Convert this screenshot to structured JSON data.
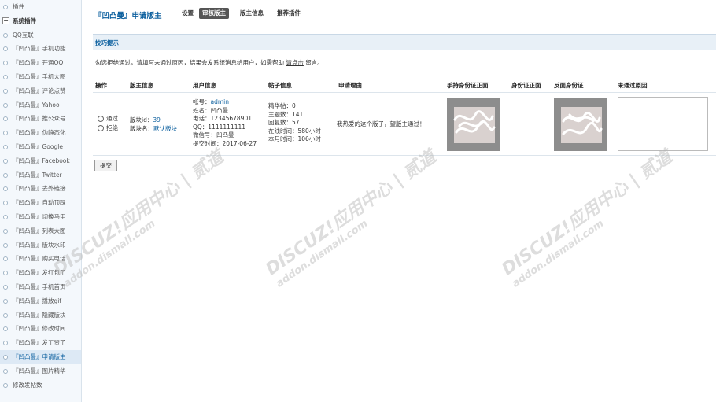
{
  "sidebar": {
    "items": [
      {
        "label": "插件",
        "type": "item"
      },
      {
        "label": "系统插件",
        "type": "group",
        "expander": "−"
      },
      {
        "label": "QQ互联",
        "type": "item"
      },
      {
        "label": "『凹凸曼』手机功能",
        "type": "item"
      },
      {
        "label": "『凹凸曼』开通QQ",
        "type": "item"
      },
      {
        "label": "『凹凸曼』手机大图",
        "type": "item"
      },
      {
        "label": "『凹凸曼』评论点赞",
        "type": "item"
      },
      {
        "label": "『凹凸曼』Yahoo",
        "type": "item"
      },
      {
        "label": "『凹凸曼』推公众号",
        "type": "item"
      },
      {
        "label": "『凹凸曼』伪静态化",
        "type": "item"
      },
      {
        "label": "『凹凸曼』Google",
        "type": "item"
      },
      {
        "label": "『凹凸曼』Facebook",
        "type": "item"
      },
      {
        "label": "『凹凸曼』Twitter",
        "type": "item"
      },
      {
        "label": "『凹凸曼』去外链接",
        "type": "item"
      },
      {
        "label": "『凹凸曼』自动顶踩",
        "type": "item"
      },
      {
        "label": "『凹凸曼』切换马甲",
        "type": "item"
      },
      {
        "label": "『凹凸曼』列表大图",
        "type": "item"
      },
      {
        "label": "『凹凸曼』版块水印",
        "type": "item"
      },
      {
        "label": "『凹凸曼』购买电话",
        "type": "item"
      },
      {
        "label": "『凹凸曼』发红包了",
        "type": "item"
      },
      {
        "label": "『凹凸曼』手机首页",
        "type": "item"
      },
      {
        "label": "『凹凸曼』播放gif",
        "type": "item"
      },
      {
        "label": "『凹凸曼』隐藏版块",
        "type": "item"
      },
      {
        "label": "『凹凸曼』修改时间",
        "type": "item"
      },
      {
        "label": "『凹凸曼』发工资了",
        "type": "item"
      },
      {
        "label": "『凹凸曼』申请版主",
        "type": "item",
        "active": true
      },
      {
        "label": "『凹凸曼』图片精华",
        "type": "item"
      },
      {
        "label": "修改发帖数",
        "type": "item"
      }
    ]
  },
  "header": {
    "title": "『凹凸曼』申请版主",
    "tabs": [
      {
        "label": "设置",
        "active": false
      },
      {
        "label": "审核版主",
        "active": true
      },
      {
        "label": "版主信息",
        "active": false
      },
      {
        "label": "推荐插件",
        "active": false
      }
    ]
  },
  "tips": {
    "title": "技巧提示",
    "text_before": "勾选拒绝通过，请填写未通过原因，结果会发系统消息给用户，如需帮助",
    "link": "请点击",
    "text_after": "留言。"
  },
  "table": {
    "headers": [
      "操作",
      "版主信息",
      "用户信息",
      "帖子信息",
      "申请理由",
      "手持身份证正面",
      "身份证正面",
      "反面身份证",
      "未通过原因"
    ],
    "row": {
      "action_options": [
        "通过",
        "拒绝"
      ],
      "forum_id_label": "版块id：",
      "forum_id": "39",
      "forum_name_label": "版块名：",
      "forum_name": "默认版块",
      "account_label": "帐号：",
      "account": "admin",
      "user_lines": [
        "姓名：凹凸曼",
        "电话：12345678901",
        "QQ：1111111111",
        "微信号：凹凸曼",
        "提交时间：2017-06-27"
      ],
      "post_lines": [
        "精华帖：0",
        "主题数：141",
        "回复数：57",
        "在线时间：580小时",
        "本月时间：106小时"
      ],
      "reason": "我热爱的这个版子，望版主通过！"
    }
  },
  "submit_label": "提交",
  "watermark": {
    "brand": "DISCUZ!应用中心 | 贰道",
    "url": "addon.dismall.com"
  },
  "icons": {
    "radio": "radio-circle-icon",
    "expander": "minus-box-icon"
  },
  "colors": {
    "accent": "#0b5f9e",
    "active_tab_bg": "#555555",
    "sidebar_bg": "#f4f8fc",
    "tips_bg": "#e8f0f7"
  }
}
